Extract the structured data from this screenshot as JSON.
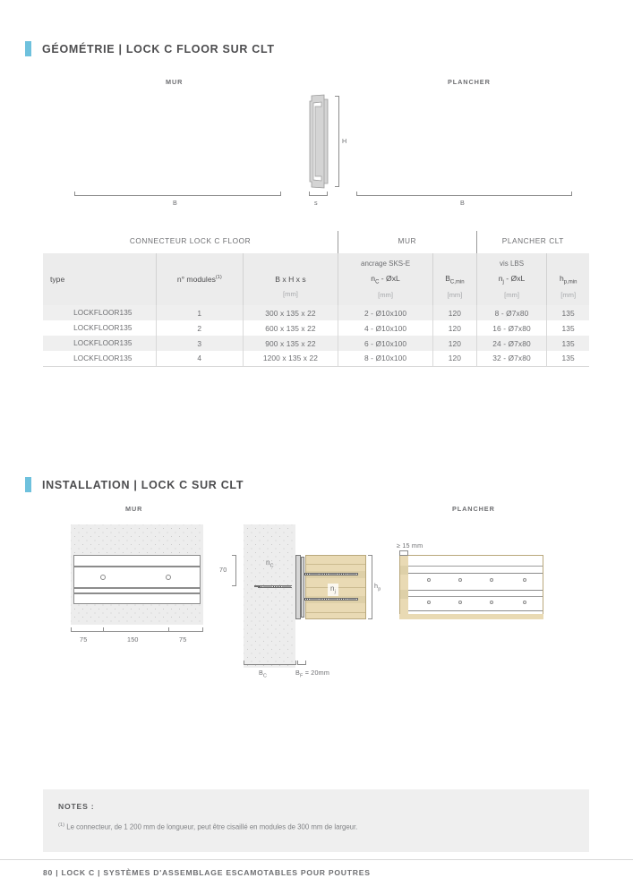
{
  "sections": {
    "geometry": {
      "title": "GÉOMÉTRIE | LOCK C FLOOR SUR CLT",
      "accent_color": "#6ec1dd"
    },
    "installation": {
      "title": "INSTALLATION | LOCK C SUR CLT",
      "accent_color": "#6ec1dd"
    }
  },
  "geometry_diagram": {
    "label_left": "MUR",
    "label_right": "PLANCHER",
    "dim_height": "H",
    "dim_thickness": "s",
    "dim_width_left": "B",
    "dim_width_right": "B"
  },
  "table": {
    "groups": [
      {
        "label": "CONNECTEUR LOCK C FLOOR",
        "span": 3
      },
      {
        "label": "MUR",
        "span": 2
      },
      {
        "label": "PLANCHER CLT",
        "span": 2
      }
    ],
    "headers": [
      {
        "sub": "",
        "sym": "type",
        "sym_sub": "",
        "unit": ""
      },
      {
        "sub": "",
        "sym": "n° modules",
        "sym_sup": "(1)",
        "unit": ""
      },
      {
        "sub": "",
        "sym": "B x H x s",
        "unit": "[mm]"
      },
      {
        "sub": "ancrage SKS-E",
        "sym": "n",
        "sym_sub": "C",
        "sym_tail": " - ØxL",
        "unit": "[mm]"
      },
      {
        "sub": "",
        "sym": "B",
        "sym_sub": "C,min",
        "unit": "[mm]"
      },
      {
        "sub": "vis LBS",
        "sym": "n",
        "sym_sub": "j",
        "sym_tail": " - ØxL",
        "unit": "[mm]"
      },
      {
        "sub": "",
        "sym": "h",
        "sym_sub": "p,min",
        "unit": "[mm]"
      }
    ],
    "rows": [
      {
        "type": "LOCKFLOOR135",
        "modules": "1",
        "bhs": "300 x 135 x 22",
        "nc": "2 - Ø10x100",
        "bcmin": "120",
        "nj": "8 - Ø7x80",
        "hpmin": "135"
      },
      {
        "type": "LOCKFLOOR135",
        "modules": "2",
        "bhs": "600 x 135 x 22",
        "nc": "4 - Ø10x100",
        "bcmin": "120",
        "nj": "16 - Ø7x80",
        "hpmin": "135"
      },
      {
        "type": "LOCKFLOOR135",
        "modules": "3",
        "bhs": "900 x 135 x 22",
        "nc": "6 - Ø10x100",
        "bcmin": "120",
        "nj": "24 - Ø7x80",
        "hpmin": "135"
      },
      {
        "type": "LOCKFLOOR135",
        "modules": "4",
        "bhs": "1200 x 135 x 22",
        "nc": "8 - Ø10x100",
        "bcmin": "120",
        "nj": "32 - Ø7x80",
        "hpmin": "135"
      }
    ]
  },
  "install_diagram": {
    "label_left": "MUR",
    "label_right": "PLANCHER",
    "left_dims": {
      "d1": "75",
      "d2": "150",
      "d3": "75"
    },
    "mid_dims": {
      "vertical_left": "70",
      "anchor_symbol": "n",
      "anchor_sub": "C",
      "screw_symbol": "n",
      "screw_sub": "j",
      "height_symbol": "h",
      "height_sub": "p",
      "width_concrete": "B",
      "width_concrete_sub": "C",
      "width_floor": "B",
      "width_floor_sub": "F",
      "width_floor_value": " = 20mm"
    },
    "right_dims": {
      "edge_distance": "≥ 15 mm"
    }
  },
  "notes": {
    "title": "NOTES :",
    "items": [
      {
        "marker": "(1)",
        "text": "Le connecteur, de 1 200 mm de longueur, peut être cisaillé en modules de 300 mm de largeur."
      }
    ]
  },
  "footer": {
    "text": "80  |  LOCK C  |  SYSTÈMES D'ASSEMBLAGE ESCAMOTABLES POUR POUTRES"
  }
}
